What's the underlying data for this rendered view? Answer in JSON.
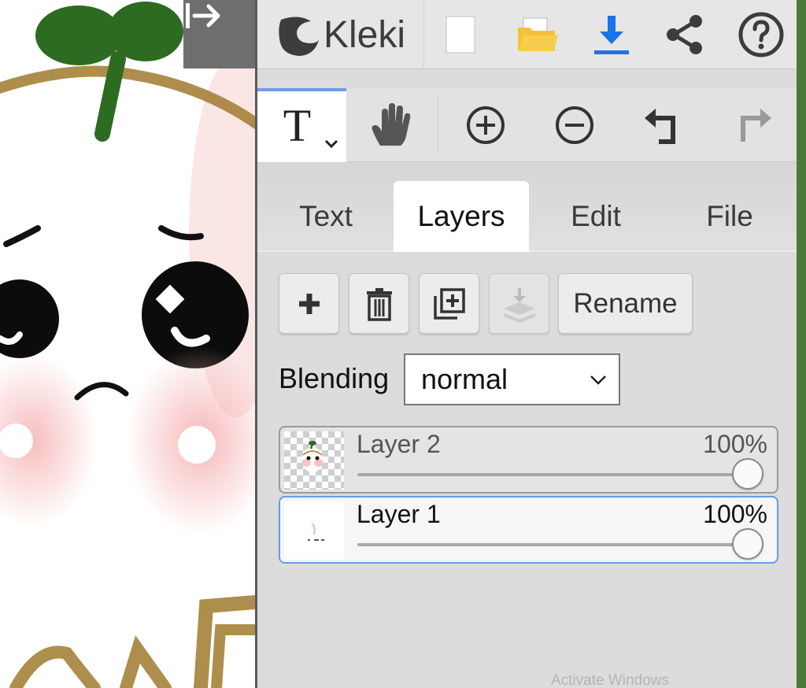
{
  "app": {
    "logo_text": "Kleki",
    "expand_panel_icon": "collapse-panel-icon"
  },
  "top_bar": {
    "icons": [
      "new-document-icon",
      "open-folder-icon",
      "download-icon",
      "share-icon",
      "help-icon"
    ],
    "colors": {
      "folder": "#f5c13a",
      "download": "#1a73e8",
      "dark": "#3c3c3c"
    }
  },
  "toolbar": {
    "active_tool": "T",
    "tools": [
      "text-tool-icon",
      "hand-tool-icon",
      "zoom-in-icon",
      "zoom-out-icon",
      "undo-icon",
      "redo-icon"
    ],
    "accent": "#6f9be8"
  },
  "tabs": [
    {
      "label": "Text"
    },
    {
      "label": "Layers",
      "active": true
    },
    {
      "label": "Edit"
    },
    {
      "label": "File"
    }
  ],
  "layers_panel": {
    "buttons": {
      "add_icon": "plus-icon",
      "delete_icon": "trash-icon",
      "duplicate_icon": "duplicate-icon",
      "merge_icon": "merge-down-icon",
      "rename_label": "Rename"
    },
    "blending_label": "Blending",
    "blending_value": "normal",
    "layers": [
      {
        "name": "Layer 2",
        "opacity": "100%",
        "opacity_value": 1.0,
        "selected": false
      },
      {
        "name": "Layer 1",
        "opacity": "100%",
        "opacity_value": 1.0,
        "selected": true
      }
    ]
  },
  "watermark": "Activate Windows"
}
